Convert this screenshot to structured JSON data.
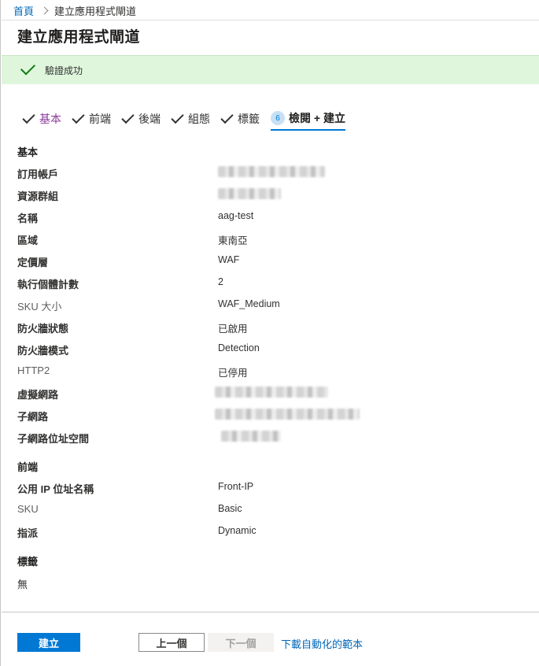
{
  "breadcrumb": {
    "home": "首頁",
    "current": "建立應用程式閘道"
  },
  "page_title": "建立應用程式閘道",
  "banner": {
    "text": "驗證成功",
    "color": "#dff6dd"
  },
  "tabs": [
    {
      "label": "基本",
      "state": "visited"
    },
    {
      "label": "前端",
      "state": "done"
    },
    {
      "label": "後端",
      "state": "done"
    },
    {
      "label": "組態",
      "state": "done"
    },
    {
      "label": "標籤",
      "state": "done"
    },
    {
      "number": "6",
      "label": "檢閱 + 建立",
      "state": "active"
    }
  ],
  "sections": {
    "basics": {
      "heading": "基本",
      "rows": [
        {
          "key": "訂用帳戶",
          "value": "",
          "redacted": true
        },
        {
          "key": "資源群組",
          "value": "",
          "redacted": true
        },
        {
          "key": "名稱",
          "value": "aag-test"
        },
        {
          "key": "區域",
          "value": "東南亞"
        },
        {
          "key": "定價層",
          "value": "WAF"
        },
        {
          "key": "執行個體計數",
          "value": "2"
        },
        {
          "key": "SKU 大小",
          "value": "WAF_Medium"
        },
        {
          "key": "防火牆狀態",
          "value": "已啟用"
        },
        {
          "key": "防火牆模式",
          "value": "Detection"
        },
        {
          "key": "HTTP2",
          "value": "已停用"
        },
        {
          "key": "虛擬網路",
          "value": "",
          "redacted": true
        },
        {
          "key": "子網路",
          "value": "",
          "redacted": true
        },
        {
          "key": "子網路位址空間",
          "value": "",
          "redacted": true
        }
      ]
    },
    "frontend": {
      "heading": "前端",
      "rows": [
        {
          "key": "公用 IP 位址名稱",
          "value": "Front-IP"
        },
        {
          "key": "SKU",
          "value": "Basic"
        },
        {
          "key": "指派",
          "value": "Dynamic"
        }
      ]
    },
    "tags": {
      "heading": "標籤",
      "value": "無"
    }
  },
  "footer": {
    "create_label": "建立",
    "previous_label": "上一個",
    "next_label": "下一個",
    "template_link": "下載自動化的範本"
  },
  "colors": {
    "accent": "#0078d4",
    "link": "#0067b8",
    "success": "#107c10"
  }
}
